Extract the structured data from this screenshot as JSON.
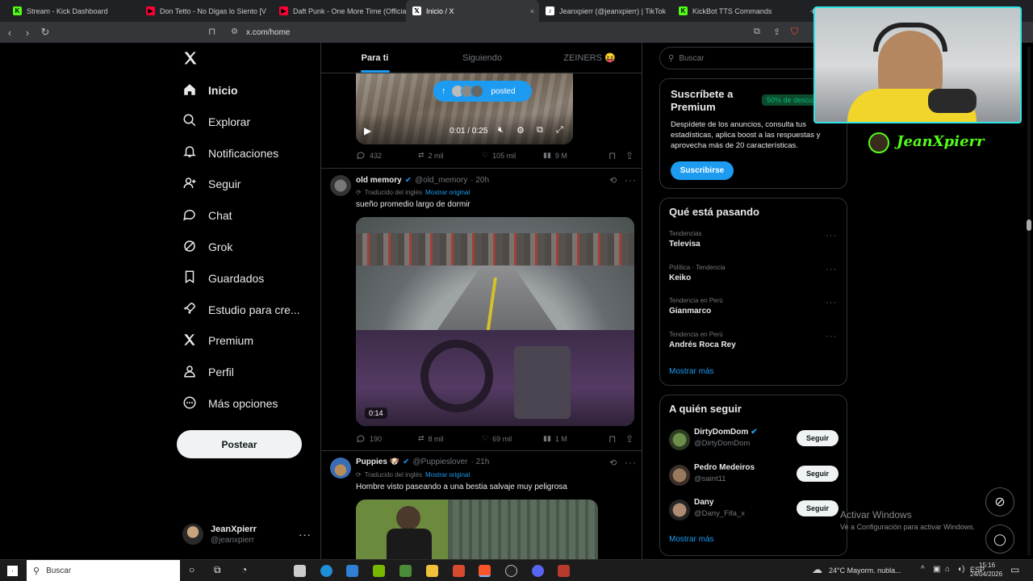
{
  "browser": {
    "tabs": [
      {
        "title": "Stream - Kick Dashboard",
        "color": "#53fc18",
        "glyph": "K"
      },
      {
        "title": "Don Tetto - No Digas lo Siento [V",
        "color": "#ff0033",
        "glyph": "▶"
      },
      {
        "title": "Daft Punk - One More Time (Official",
        "color": "#ff0033",
        "glyph": "▶"
      },
      {
        "title": "Inicio / X",
        "color": "#ffffff",
        "glyph": "𝕏"
      },
      {
        "title": "Jeanxpierr (@jeanxpierr) | TikTok",
        "color": "#ffffff",
        "glyph": "♪"
      },
      {
        "title": "KickBot TTS Commands",
        "color": "#53fc18",
        "glyph": "K"
      }
    ],
    "url": "x.com/home"
  },
  "nav": {
    "items": [
      {
        "label": "Inicio",
        "icon": "home-icon"
      },
      {
        "label": "Explorar",
        "icon": "search-icon"
      },
      {
        "label": "Notificaciones",
        "icon": "bell-icon"
      },
      {
        "label": "Seguir",
        "icon": "person-add-icon"
      },
      {
        "label": "Chat",
        "icon": "chat-icon"
      },
      {
        "label": "Grok",
        "icon": "grok-icon"
      },
      {
        "label": "Guardados",
        "icon": "bookmark-icon"
      },
      {
        "label": "Estudio para cre...",
        "icon": "rocket-icon"
      },
      {
        "label": "Premium",
        "icon": "x-logo-icon"
      },
      {
        "label": "Perfil",
        "icon": "person-icon"
      },
      {
        "label": "Más opciones",
        "icon": "more-circle-icon"
      }
    ],
    "post_button": "Postear",
    "account": {
      "name": "JeanXpierr",
      "handle": "@jeanxpierr"
    }
  },
  "feed": {
    "tabs": [
      "Para ti",
      "Siguiendo",
      "ZEINERS 😝"
    ],
    "posted_pill": "posted",
    "video1": {
      "time": "0:01 / 0:25"
    },
    "post1_stats": {
      "replies": "432",
      "reposts": "2 mil",
      "likes": "105 mil",
      "views": "9 M"
    },
    "post2": {
      "name": "old memory",
      "handle": "@old_memory",
      "time": "· 20h",
      "translated": "Traducido del inglés",
      "show_original": "Mostrar original",
      "text": "sueño promedio largo de dormir",
      "duration": "0:14",
      "stats": {
        "replies": "190",
        "reposts": "8 mil",
        "likes": "69 mil",
        "views": "1 M"
      }
    },
    "post3": {
      "name": "Puppies 🐶",
      "handle": "@Puppieslover",
      "time": "· 21h",
      "translated": "Traducido del inglés",
      "show_original": "Mostrar original",
      "text": "Hombre visto paseando a una bestia salvaje muy peligrosa"
    }
  },
  "right": {
    "search_placeholder": "Buscar",
    "premium": {
      "title": "Suscríbete a Premium",
      "badge": "50% de descu",
      "body": "Despídete de los anuncios, consulta tus estadísticas, aplica boost a las respuestas y aprovecha más de 20 características.",
      "button": "Suscribirse"
    },
    "trends_title": "Qué está pasando",
    "trends": [
      {
        "context": "Tendencias",
        "topic": "Televisa"
      },
      {
        "context": "Política · Tendencia",
        "topic": "Keiko"
      },
      {
        "context": "Tendencia en Perú",
        "topic": "Gianmarco"
      },
      {
        "context": "Tendencia en Perú",
        "topic": "Andrés Roca Rey"
      }
    ],
    "show_more": "Mostrar más",
    "follow_title": "A quién seguir",
    "follow": [
      {
        "name": "DirtyDomDom",
        "handle": "@DirtyDomDom",
        "verified": true,
        "button": "Seguir"
      },
      {
        "name": "Pedro Medeiros",
        "handle": "@saint11",
        "verified": false,
        "button": "Seguir"
      },
      {
        "name": "Dany",
        "handle": "@Dany_Fifa_x",
        "verified": false,
        "button": "Seguir"
      }
    ],
    "follow_more": "Mostrar más"
  },
  "overlay": {
    "streamer_name": "JeanXpierr",
    "watermark_title": "Activar Windows",
    "watermark_sub": "Ve a Configuración para activar Windows."
  },
  "taskbar": {
    "search": "Buscar",
    "weather": "24°C  Mayorm. nubla...",
    "time": "15:16",
    "date": "24/04/2026"
  }
}
